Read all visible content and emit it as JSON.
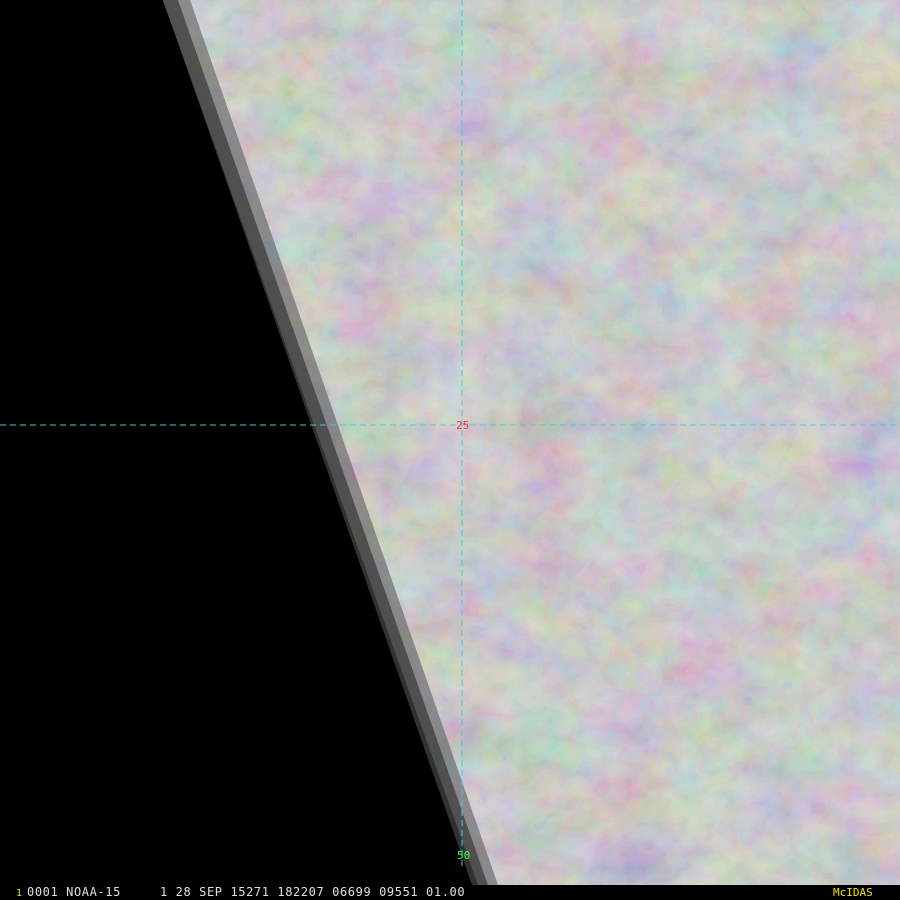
{
  "image": {
    "description_colors": {
      "background": "#000000",
      "cloud_gray_light": "#b4b4b4",
      "cloud_gray_dark": "#4a4a4a",
      "limb_edge": "#3c3c3c",
      "grid_line": "#40d0d0",
      "center_label": "#ff3030",
      "bottom_label": "#40ff40"
    }
  },
  "grid": {
    "center_label": "25",
    "bottom_label": "50"
  },
  "status_bar": {
    "frame_number": "1",
    "text": "0001 NOAA-15     1 28 SEP 15271 182207 06699 09551 01.00",
    "software": "McIDAS"
  }
}
